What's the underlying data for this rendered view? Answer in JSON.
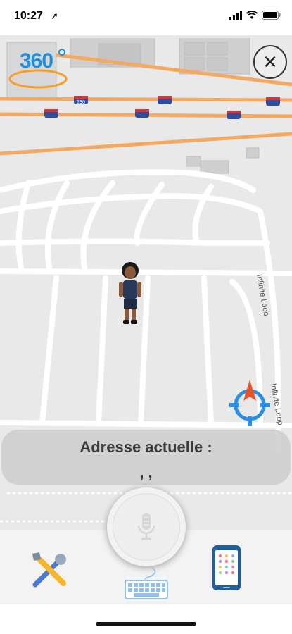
{
  "status_bar": {
    "time": "10:27"
  },
  "map": {
    "badge_360": "360",
    "road_labels": [
      "Infinite Loop",
      "Infinite Loop"
    ],
    "highway_shield": "280"
  },
  "address_panel": {
    "label": "Adresse actuelle :",
    "value": ", ,"
  },
  "icons": {
    "close": "close-icon",
    "compass": "compass-icon",
    "mic": "microphone-icon",
    "tools": "tools-icon",
    "keyboard": "keyboard-icon",
    "phone": "phone-apps-icon"
  },
  "colors": {
    "accent": "#1d8fe0",
    "highway": "#f5a85f",
    "compass_arrow": "#e8542a",
    "close_bg": "#ffffff"
  }
}
